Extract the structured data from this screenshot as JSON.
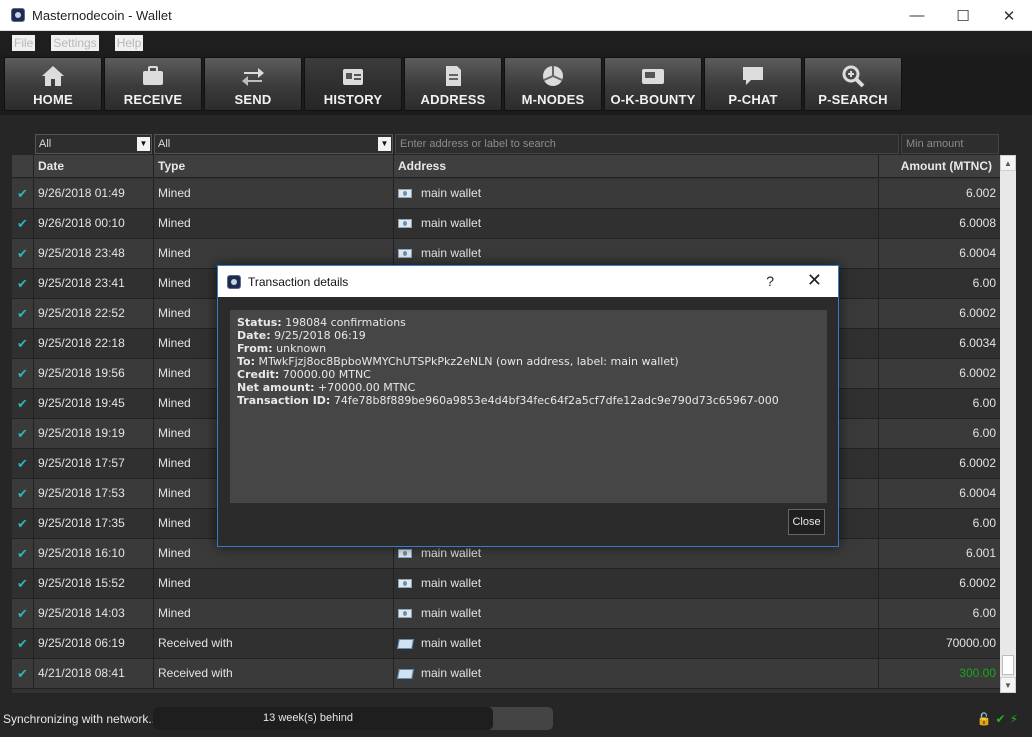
{
  "window": {
    "title": "Masternodecoin - Wallet"
  },
  "menu": [
    "File",
    "Settings",
    "Help"
  ],
  "toolbar": [
    {
      "label": "HOME",
      "icon": "home-icon"
    },
    {
      "label": "RECEIVE",
      "icon": "receive-icon"
    },
    {
      "label": "SEND",
      "icon": "send-icon"
    },
    {
      "label": "HISTORY",
      "icon": "history-icon",
      "active": true
    },
    {
      "label": "ADDRESS",
      "icon": "address-icon"
    },
    {
      "label": "M-NODES",
      "icon": "mnodes-icon"
    },
    {
      "label": "O-K-BOUNTY",
      "icon": "bounty-icon"
    },
    {
      "label": "P-CHAT",
      "icon": "chat-icon"
    },
    {
      "label": "P-SEARCH",
      "icon": "search-icon"
    }
  ],
  "filters": {
    "date_filter": "All",
    "type_filter": "All",
    "search_placeholder": "Enter address or label to search",
    "min_amount_placeholder": "Min amount"
  },
  "table": {
    "columns": [
      "Date",
      "Type",
      "Address",
      "Amount (MTNC)"
    ],
    "rows": [
      {
        "date": "9/26/2018 01:49",
        "type": "Mined",
        "address": "main wallet",
        "amount": "6.002",
        "kind": "mined"
      },
      {
        "date": "9/26/2018 00:10",
        "type": "Mined",
        "address": "main wallet",
        "amount": "6.0008",
        "kind": "mined"
      },
      {
        "date": "9/25/2018 23:48",
        "type": "Mined",
        "address": "main wallet",
        "amount": "6.0004",
        "kind": "mined"
      },
      {
        "date": "9/25/2018 23:41",
        "type": "Mined",
        "address": "",
        "amount": "6.00",
        "kind": "mined"
      },
      {
        "date": "9/25/2018 22:52",
        "type": "Mined",
        "address": "",
        "amount": "6.0002",
        "kind": "mined"
      },
      {
        "date": "9/25/2018 22:18",
        "type": "Mined",
        "address": "",
        "amount": "6.0034",
        "kind": "mined"
      },
      {
        "date": "9/25/2018 19:56",
        "type": "Mined",
        "address": "",
        "amount": "6.0002",
        "kind": "mined"
      },
      {
        "date": "9/25/2018 19:45",
        "type": "Mined",
        "address": "",
        "amount": "6.00",
        "kind": "mined"
      },
      {
        "date": "9/25/2018 19:19",
        "type": "Mined",
        "address": "",
        "amount": "6.00",
        "kind": "mined"
      },
      {
        "date": "9/25/2018 17:57",
        "type": "Mined",
        "address": "",
        "amount": "6.0002",
        "kind": "mined"
      },
      {
        "date": "9/25/2018 17:53",
        "type": "Mined",
        "address": "",
        "amount": "6.0004",
        "kind": "mined"
      },
      {
        "date": "9/25/2018 17:35",
        "type": "Mined",
        "address": "",
        "amount": "6.00",
        "kind": "mined"
      },
      {
        "date": "9/25/2018 16:10",
        "type": "Mined",
        "address": "main wallet",
        "amount": "6.001",
        "kind": "mined"
      },
      {
        "date": "9/25/2018 15:52",
        "type": "Mined",
        "address": "main wallet",
        "amount": "6.0002",
        "kind": "mined"
      },
      {
        "date": "9/25/2018 14:03",
        "type": "Mined",
        "address": "main wallet",
        "amount": "6.00",
        "kind": "mined"
      },
      {
        "date": "9/25/2018 06:19",
        "type": "Received with",
        "address": "main wallet",
        "amount": "70000.00",
        "kind": "received"
      },
      {
        "date": "4/21/2018 08:41",
        "type": "Received with",
        "address": "main wallet",
        "amount": "300.00",
        "kind": "received",
        "amount_color": "#18a818"
      }
    ]
  },
  "dialog": {
    "title": "Transaction details",
    "help": "?",
    "lines": [
      {
        "label": "Status:",
        "value": " 198084 confirmations"
      },
      {
        "label": "Date:",
        "value": " 9/25/2018 06:19"
      },
      {
        "label": "From:",
        "value": " unknown"
      },
      {
        "label": "To:",
        "value": " MTwkFjzj8oc8BpboWMYChUTSPkPkz2eNLN (own address, label: main wallet)"
      },
      {
        "label": "Credit:",
        "value": " 70000.00 MTNC"
      },
      {
        "label": "Net amount:",
        "value": " +70000.00 MTNC"
      },
      {
        "label": "Transaction ID:",
        "value": " 74fe78b8f889be960a9853e4d4bf34fec64f2a5cf7dfe12adc9e790d73c65967-000"
      }
    ],
    "close_label": "Close"
  },
  "status": {
    "sync_text": "Synchronizing with network...",
    "progress_text": "13 week(s) behind",
    "progress_fraction": 0.85
  }
}
